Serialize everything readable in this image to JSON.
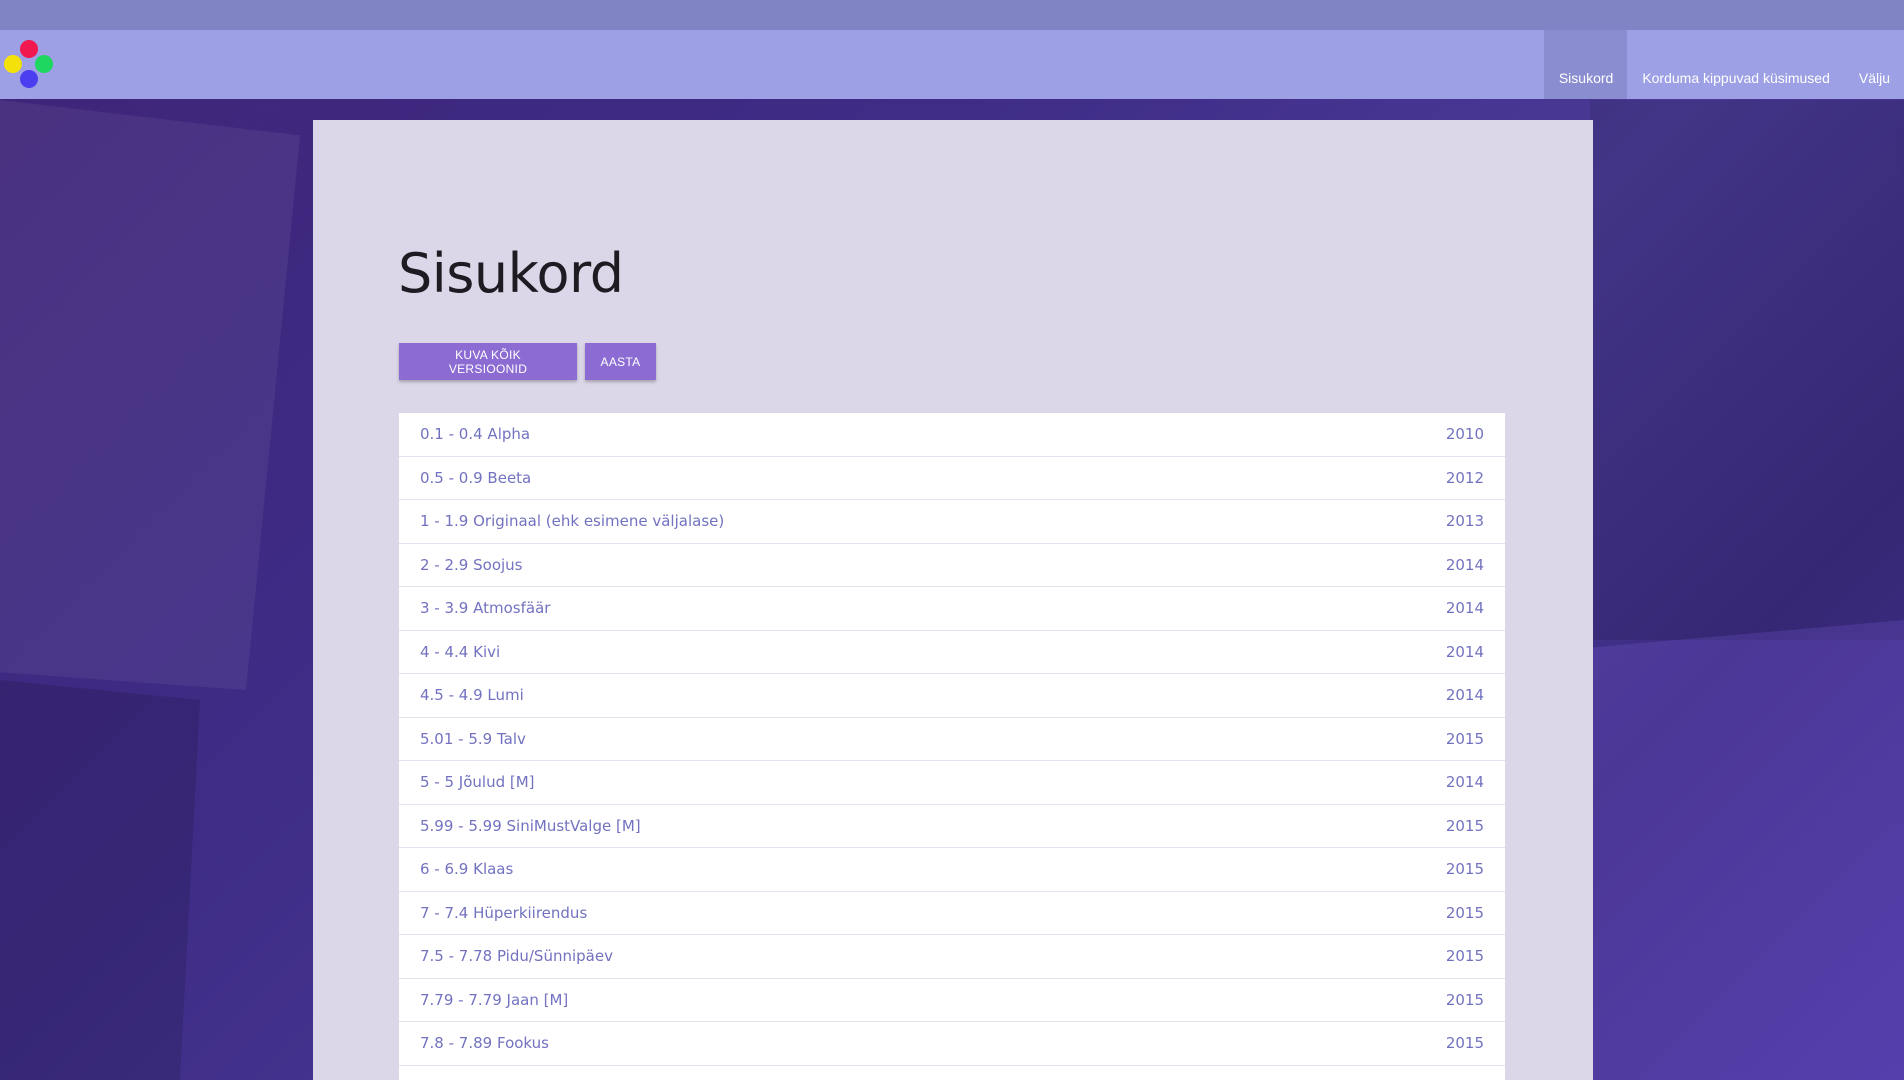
{
  "colors": {
    "accent": "#8c6cd2",
    "navbar": "#9da0e4",
    "link": "#7272c0"
  },
  "logo": {
    "icon": "four-circles-logo"
  },
  "nav": {
    "items": [
      {
        "label": "Sisukord",
        "active": true
      },
      {
        "label": "Korduma kippuvad küsimused",
        "active": false
      },
      {
        "label": "Välju",
        "active": false
      }
    ]
  },
  "page": {
    "title": "Sisukord"
  },
  "buttons": {
    "show_all": "KUVA KÕIK VERSIOONID",
    "year": "AASTA"
  },
  "versions": [
    {
      "label": "0.1 - 0.4 Alpha",
      "year": "2010"
    },
    {
      "label": "0.5 - 0.9 Beeta",
      "year": "2012"
    },
    {
      "label": "1 - 1.9 Originaal (ehk esimene väljalase)",
      "year": "2013"
    },
    {
      "label": "2 - 2.9 Soojus",
      "year": "2014"
    },
    {
      "label": "3 - 3.9 Atmosfäär",
      "year": "2014"
    },
    {
      "label": "4 - 4.4 Kivi",
      "year": "2014"
    },
    {
      "label": "4.5 - 4.9 Lumi",
      "year": "2014"
    },
    {
      "label": "5.01 - 5.9 Talv",
      "year": "2015"
    },
    {
      "label": "5 - 5 Jõulud [M]",
      "year": "2014"
    },
    {
      "label": "5.99 - 5.99 SiniMustValge [M]",
      "year": "2015"
    },
    {
      "label": "6 - 6.9 Klaas",
      "year": "2015"
    },
    {
      "label": "7 - 7.4 Hüperkiirendus",
      "year": "2015"
    },
    {
      "label": "7.5 - 7.78 Pidu/Sünnipäev",
      "year": "2015"
    },
    {
      "label": "7.79 - 7.79 Jaan [M]",
      "year": "2015"
    },
    {
      "label": "7.8 - 7.89 Fookus",
      "year": "2015"
    }
  ]
}
